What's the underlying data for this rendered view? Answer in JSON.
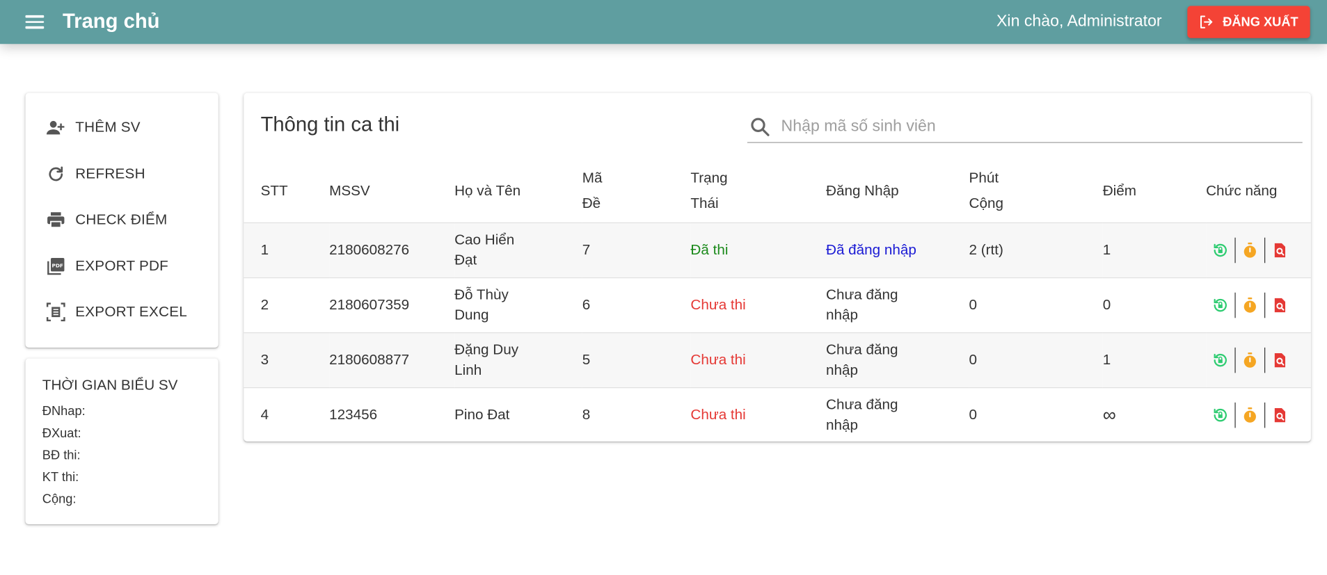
{
  "appbar": {
    "title": "Trang chủ",
    "greeting": "Xin chào, Administrator",
    "logout_label": "ĐĂNG XUẤT"
  },
  "sidebar": {
    "items": [
      {
        "label": "THÊM SV",
        "icon": "add-user-icon"
      },
      {
        "label": "REFRESH",
        "icon": "refresh-icon"
      },
      {
        "label": "CHECK ĐIỂM",
        "icon": "printer-icon"
      },
      {
        "label": "EXPORT PDF",
        "icon": "pdf-icon"
      },
      {
        "label": "EXPORT EXCEL",
        "icon": "excel-icon"
      }
    ]
  },
  "schedule": {
    "title": "THỜI GIAN BIỂU SV",
    "rows": [
      "ĐNhap:",
      "ĐXuat:",
      "BĐ thi:",
      "KT thi:",
      "Cộng:"
    ]
  },
  "main": {
    "title": "Thông tin ca thi",
    "search_placeholder": "Nhập mã số sinh viên",
    "headers": {
      "stt": "STT",
      "mssv": "MSSV",
      "name": "Họ và Tên",
      "made_1": "Mã",
      "made_2": "Đề",
      "status_1": "Trạng",
      "status_2": "Thái",
      "login": "Đăng Nhập",
      "phut_1": "Phút",
      "phut_2": "Cộng",
      "diem": "Điểm",
      "actions": "Chức năng"
    },
    "rows": [
      {
        "stt": "1",
        "mssv": "2180608276",
        "name_1": "Cao Hiển",
        "name_2": "Đạt",
        "made": "7",
        "status": "Đã thi",
        "login_1": "Đã đăng nhập",
        "login_2": "",
        "phut": "2 (rtt)",
        "diem": "1"
      },
      {
        "stt": "2",
        "mssv": "2180607359",
        "name_1": "Đỗ Thùy",
        "name_2": "Dung",
        "made": "6",
        "status": "Chưa thi",
        "login_1": "Chưa đăng",
        "login_2": "nhập",
        "phut": "0",
        "diem": "0"
      },
      {
        "stt": "3",
        "mssv": "2180608877",
        "name_1": "Đặng Duy",
        "name_2": "Linh",
        "made": "5",
        "status": "Chưa thi",
        "login_1": "Chưa đăng",
        "login_2": "nhập",
        "phut": "0",
        "diem": "1"
      },
      {
        "stt": "4",
        "mssv": "123456",
        "name_1": "Pino Đat",
        "name_2": "",
        "made": "8",
        "status": "Chưa thi",
        "login_1": "Chưa đăng",
        "login_2": "nhập",
        "phut": "0",
        "diem": "∞"
      }
    ]
  },
  "colors": {
    "appbar": "#5f9ea0",
    "logout": "#f44336",
    "status_done": "#1b8a1b",
    "status_not": "#e53935",
    "logged_in": "#1a1ad4",
    "action_green": "#2ecc71",
    "action_orange": "#f5a623",
    "action_red": "#e53935"
  }
}
